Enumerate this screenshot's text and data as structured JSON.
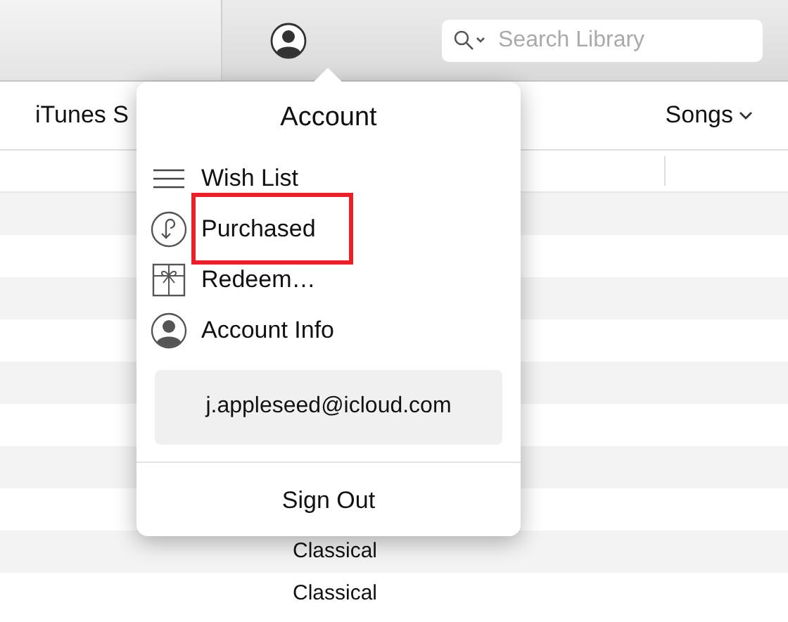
{
  "toolbar": {
    "search": {
      "placeholder": "Search Library"
    }
  },
  "nav": {
    "left_label": "iTunes S",
    "view_menu": "Songs"
  },
  "account_popover": {
    "title": "Account",
    "items": [
      {
        "label": "Wish List",
        "kind": "list",
        "highlighted": false
      },
      {
        "label": "Purchased",
        "kind": "purchased",
        "highlighted": true
      },
      {
        "label": "Redeem…",
        "kind": "gift",
        "highlighted": false
      },
      {
        "label": "Account Info",
        "kind": "person",
        "highlighted": false
      }
    ],
    "email": "j.appleseed@icloud.com",
    "sign_out": "Sign Out"
  },
  "table": {
    "rows": [
      {
        "genre": "Classical"
      },
      {
        "genre": "Classical"
      }
    ]
  }
}
